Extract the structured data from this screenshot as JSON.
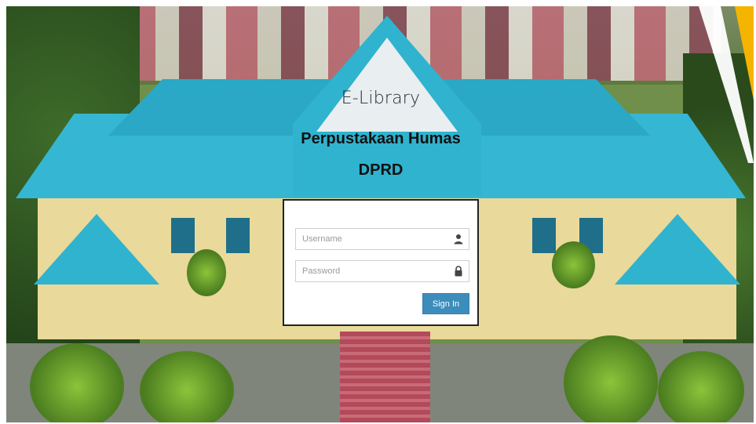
{
  "header": {
    "subtitle": "E-Library",
    "title_line1": "Perpustakaan Humas",
    "title_line2": "DPRD"
  },
  "login": {
    "username_placeholder": "Username",
    "password_placeholder": "Password",
    "submit_label": "Sign In"
  },
  "icons": {
    "username": "user-icon",
    "password": "lock-icon"
  },
  "colors": {
    "button": "#3c8dbc",
    "roof": "#2fb3cf"
  }
}
